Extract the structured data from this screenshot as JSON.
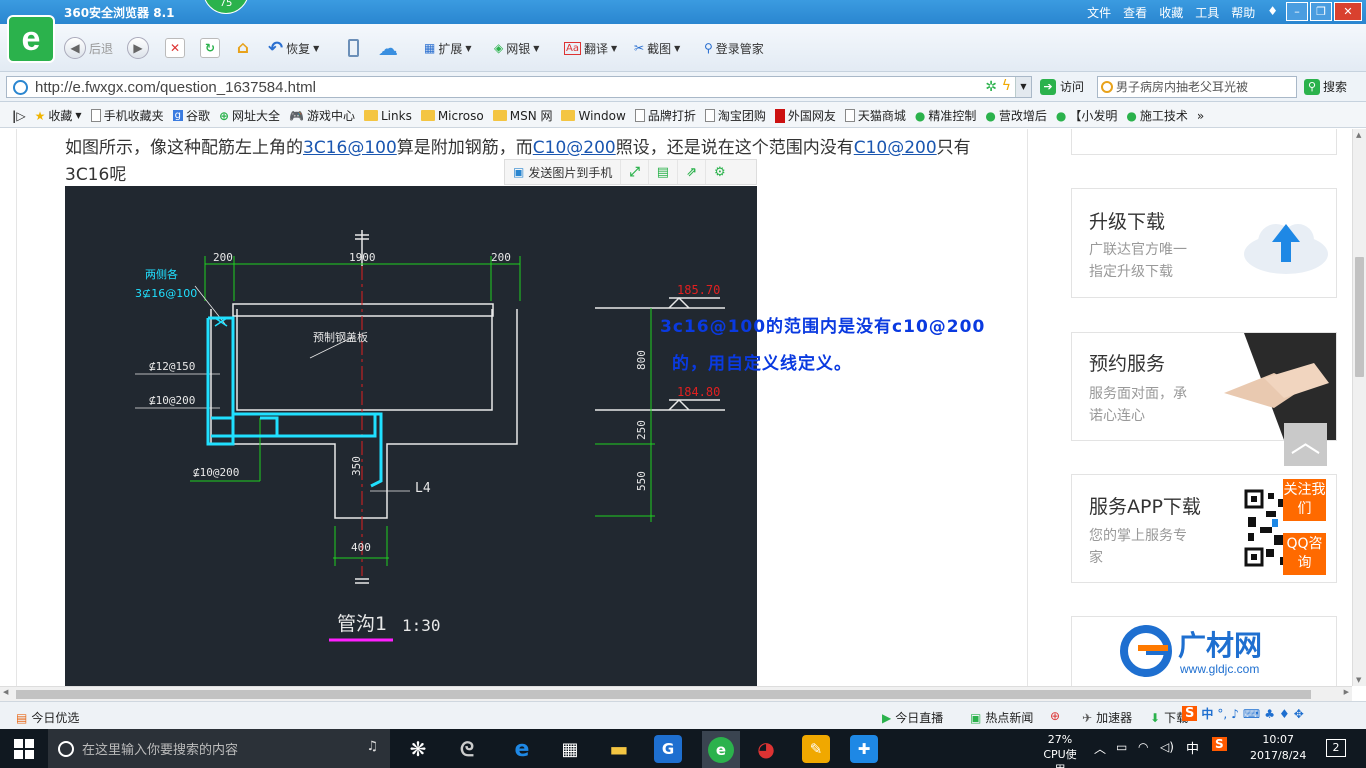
{
  "browser": {
    "title": "360安全浏览器 8.1",
    "score": "75",
    "menu": [
      "文件",
      "查看",
      "收藏",
      "工具",
      "帮助"
    ],
    "toolbar": {
      "back": "后退",
      "restore": "恢复",
      "extend": "扩展",
      "netbank": "网银",
      "translate": "翻译",
      "screenshot": "截图",
      "login_manager": "登录管家"
    },
    "url": "http://e.fwxgx.com/question_1637584.html",
    "go_label": "访问",
    "search_value": "男子病房内抽老父耳光被",
    "search_label": "搜索",
    "bookmarks": [
      "收藏",
      "手机收藏夹",
      "谷歌",
      "网址大全",
      "游戏中心",
      "Links",
      "Microso",
      "MSN 网",
      "Window",
      "品牌打折",
      "淘宝团购",
      "外国网友",
      "天猫商城",
      "精准控制",
      "营改增后",
      "【小发明",
      "施工技术"
    ]
  },
  "question": {
    "t1": "如图所示，像这种配筋左上角的",
    "l1": "3C16@100",
    "t2": "算是附加钢筋，而",
    "l2": "C10@200",
    "t3": "照设，还是说在这个范围内没有",
    "l3": "C10@200",
    "t4": "只有3C16呢"
  },
  "image_toolbar": {
    "send": "发送图片到手机"
  },
  "drawing": {
    "dim_left": "200",
    "dim_mid": "1900",
    "dim_right": "200",
    "label_both_sides": "两侧各",
    "label_3c16": "3⊈16@100",
    "label_cover": "预制钢盖板",
    "label_c12": "⊈12@150",
    "label_c10a": "⊈10@200",
    "label_c10b": "⊈10@200",
    "elev_top": "185.70",
    "elev_bottom": "184.80",
    "dim_800": "800",
    "dim_250": "250",
    "dim_550": "550",
    "dim_350": "350",
    "dim_400": "400",
    "label_l4": "L4",
    "caption": "管沟1",
    "scale": "1:30"
  },
  "answer": {
    "line1": "3c16@100的范围内是没有c10@200",
    "line2": "的，用自定义线定义。"
  },
  "sidebar": {
    "upgrade_title": "升级下载",
    "upgrade_desc1": "广联达官方唯一",
    "upgrade_desc2": "指定升级下载",
    "booking_title": "预约服务",
    "booking_desc1": "服务面对面，承",
    "booking_desc2": "诺心连心",
    "app_title": "服务APP下载",
    "app_desc1": "您的掌上服务专",
    "app_desc2": "家",
    "follow": "关注我们",
    "qq": "QQ咨询",
    "gldjc_name": "广材网",
    "gldjc_url": "www.gldjc.com"
  },
  "status": {
    "today_pick": "今日优选",
    "live": "今日直播",
    "hot_news": "热点新闻",
    "accelerator": "加速器",
    "download": "下载",
    "ime": "中"
  },
  "taskbar": {
    "search_placeholder": "在这里输入你要搜索的内容",
    "cpu_percent": "27%",
    "cpu_label": "CPU使用",
    "ime": "中",
    "time": "10:07",
    "date": "2017/8/24",
    "notifications": "2"
  }
}
